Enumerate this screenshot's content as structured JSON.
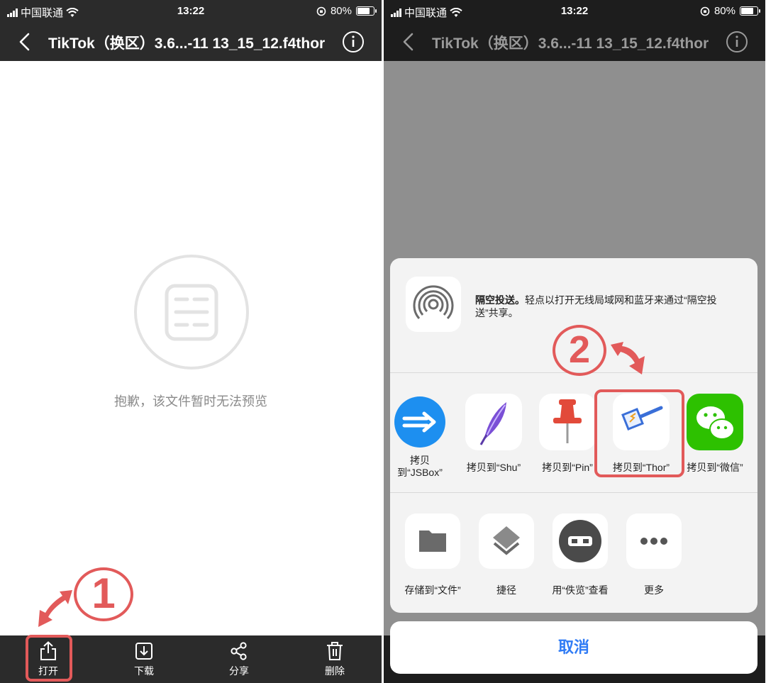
{
  "status_bar": {
    "carrier": "中国联通",
    "time": "13:22",
    "battery": "80%",
    "battery_level": 0.8
  },
  "nav": {
    "title": "TikTok（换区）3.6...-11 13_15_12.f4thor"
  },
  "preview": {
    "message": "抱歉，该文件暂时无法预览"
  },
  "toolbar": {
    "items": [
      {
        "label": "打开",
        "icon": "share-upload-icon"
      },
      {
        "label": "下载",
        "icon": "download-icon"
      },
      {
        "label": "分享",
        "icon": "share-nodes-icon"
      },
      {
        "label": "删除",
        "icon": "trash-icon"
      }
    ]
  },
  "annotations": {
    "step1": "1",
    "step2": "2"
  },
  "share_sheet": {
    "airdrop": {
      "title": "隔空投送。",
      "text": "轻点以打开无线局域网和蓝牙来通过“隔空投送”共享。"
    },
    "apps": [
      {
        "label_line1": "拷贝",
        "label_line2": "到“JSBox”",
        "icon": "jsbox-icon"
      },
      {
        "label": "拷贝到“Shu”",
        "icon": "shu-feather-icon"
      },
      {
        "label": "拷贝到“Pin”",
        "icon": "pin-icon"
      },
      {
        "label": "拷贝到“Thor”",
        "icon": "thor-hammer-icon"
      },
      {
        "label": "拷贝到“微信”",
        "icon": "wechat-icon"
      }
    ],
    "actions": [
      {
        "label": "存储到“文件”",
        "icon": "folder-icon"
      },
      {
        "label": "捷径",
        "icon": "shortcuts-icon"
      },
      {
        "label": "用“佚览”查看",
        "icon": "viewer-icon"
      },
      {
        "label": "更多",
        "icon": "more-icon"
      }
    ],
    "cancel": "取消"
  },
  "colors": {
    "annotation_red": "#e25a5a",
    "cancel_blue": "#2f7bf5",
    "bar_dark": "#2b2b2b"
  }
}
